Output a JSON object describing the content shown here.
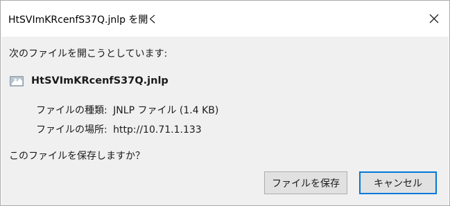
{
  "window": {
    "title": "HtSVImKRcenfS37Q.jnlp を開く",
    "close_icon": "close-icon"
  },
  "body": {
    "intro": "次のファイルを開こうとしています:",
    "file": {
      "icon": "java-webstart-file-icon",
      "name": "HtSVImKRcenfS37Q.jnlp"
    },
    "type": {
      "label": "ファイルの種類:",
      "value": "JNLP ファイル (1.4 KB)"
    },
    "location": {
      "label": "ファイルの場所:",
      "value": "http://10.71.1.133"
    },
    "question": "このファイルを保存しますか？"
  },
  "buttons": {
    "save": "ファイルを保存",
    "cancel": "キャンセル"
  },
  "colors": {
    "client_bg": "#f0f0f0",
    "button_bg": "#e1e1e1",
    "focus_border": "#0078d7"
  }
}
